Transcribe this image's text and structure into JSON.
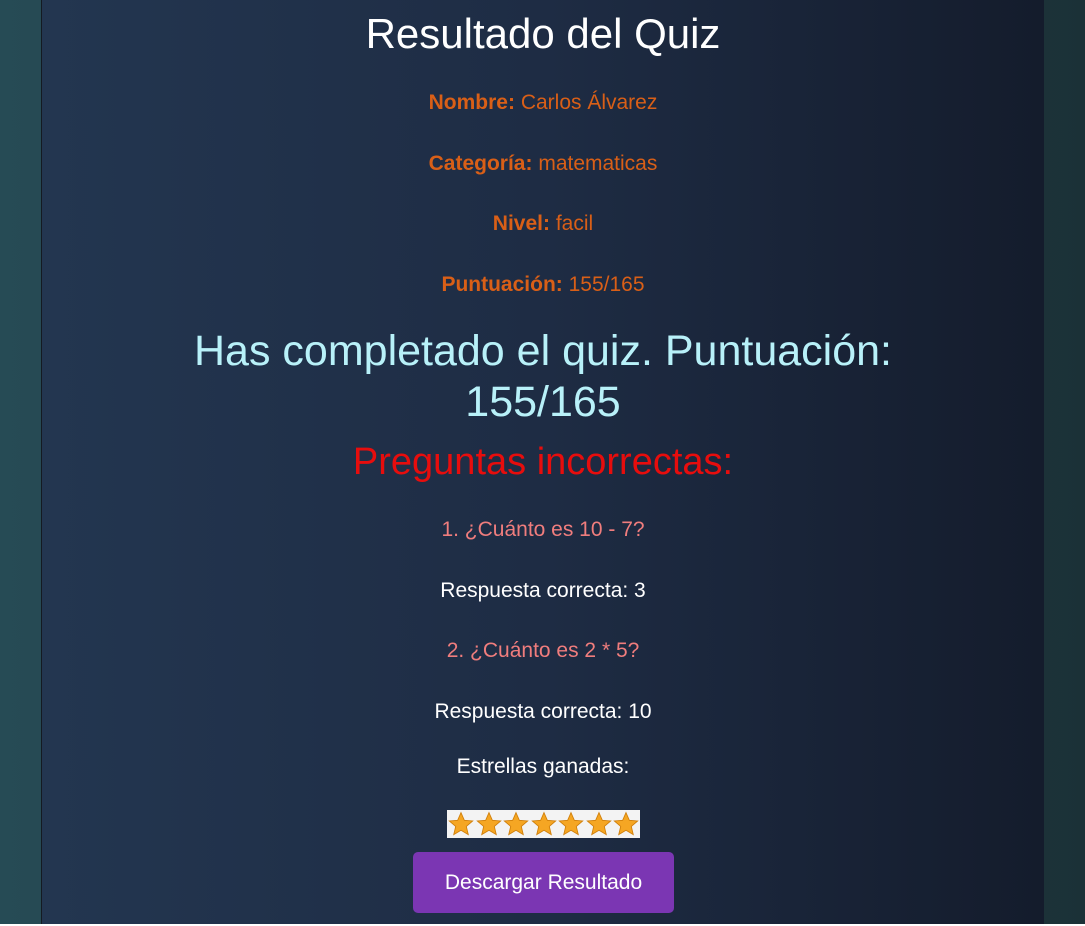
{
  "page": {
    "title": "Resultado del Quiz"
  },
  "info": {
    "name_label": "Nombre:",
    "name_value": "Carlos Álvarez",
    "category_label": "Categoría:",
    "category_value": "matematicas",
    "level_label": "Nivel:",
    "level_value": "facil",
    "score_label": "Puntuación:",
    "score_value": "155/165"
  },
  "completion": {
    "message": "Has completado el quiz. Puntuación: 155/165"
  },
  "incorrect": {
    "heading": "Preguntas incorrectas:",
    "items": [
      {
        "question": "1. ¿Cuánto es 10 - 7?",
        "answer": "Respuesta correcta: 3"
      },
      {
        "question": "2. ¿Cuánto es 2 * 5?",
        "answer": "Respuesta correcta: 10"
      }
    ]
  },
  "stars": {
    "label": "Estrellas ganadas:",
    "count": 7,
    "icon": "star-icon",
    "color": "#f5a623"
  },
  "actions": {
    "download_label": "Descargar Resultado"
  },
  "colors": {
    "info_text": "#d95f17",
    "completion_text": "#b8f1f9",
    "error_heading": "#e70d0d",
    "question_text": "#f07d7d",
    "button_bg": "#7b36b3"
  }
}
